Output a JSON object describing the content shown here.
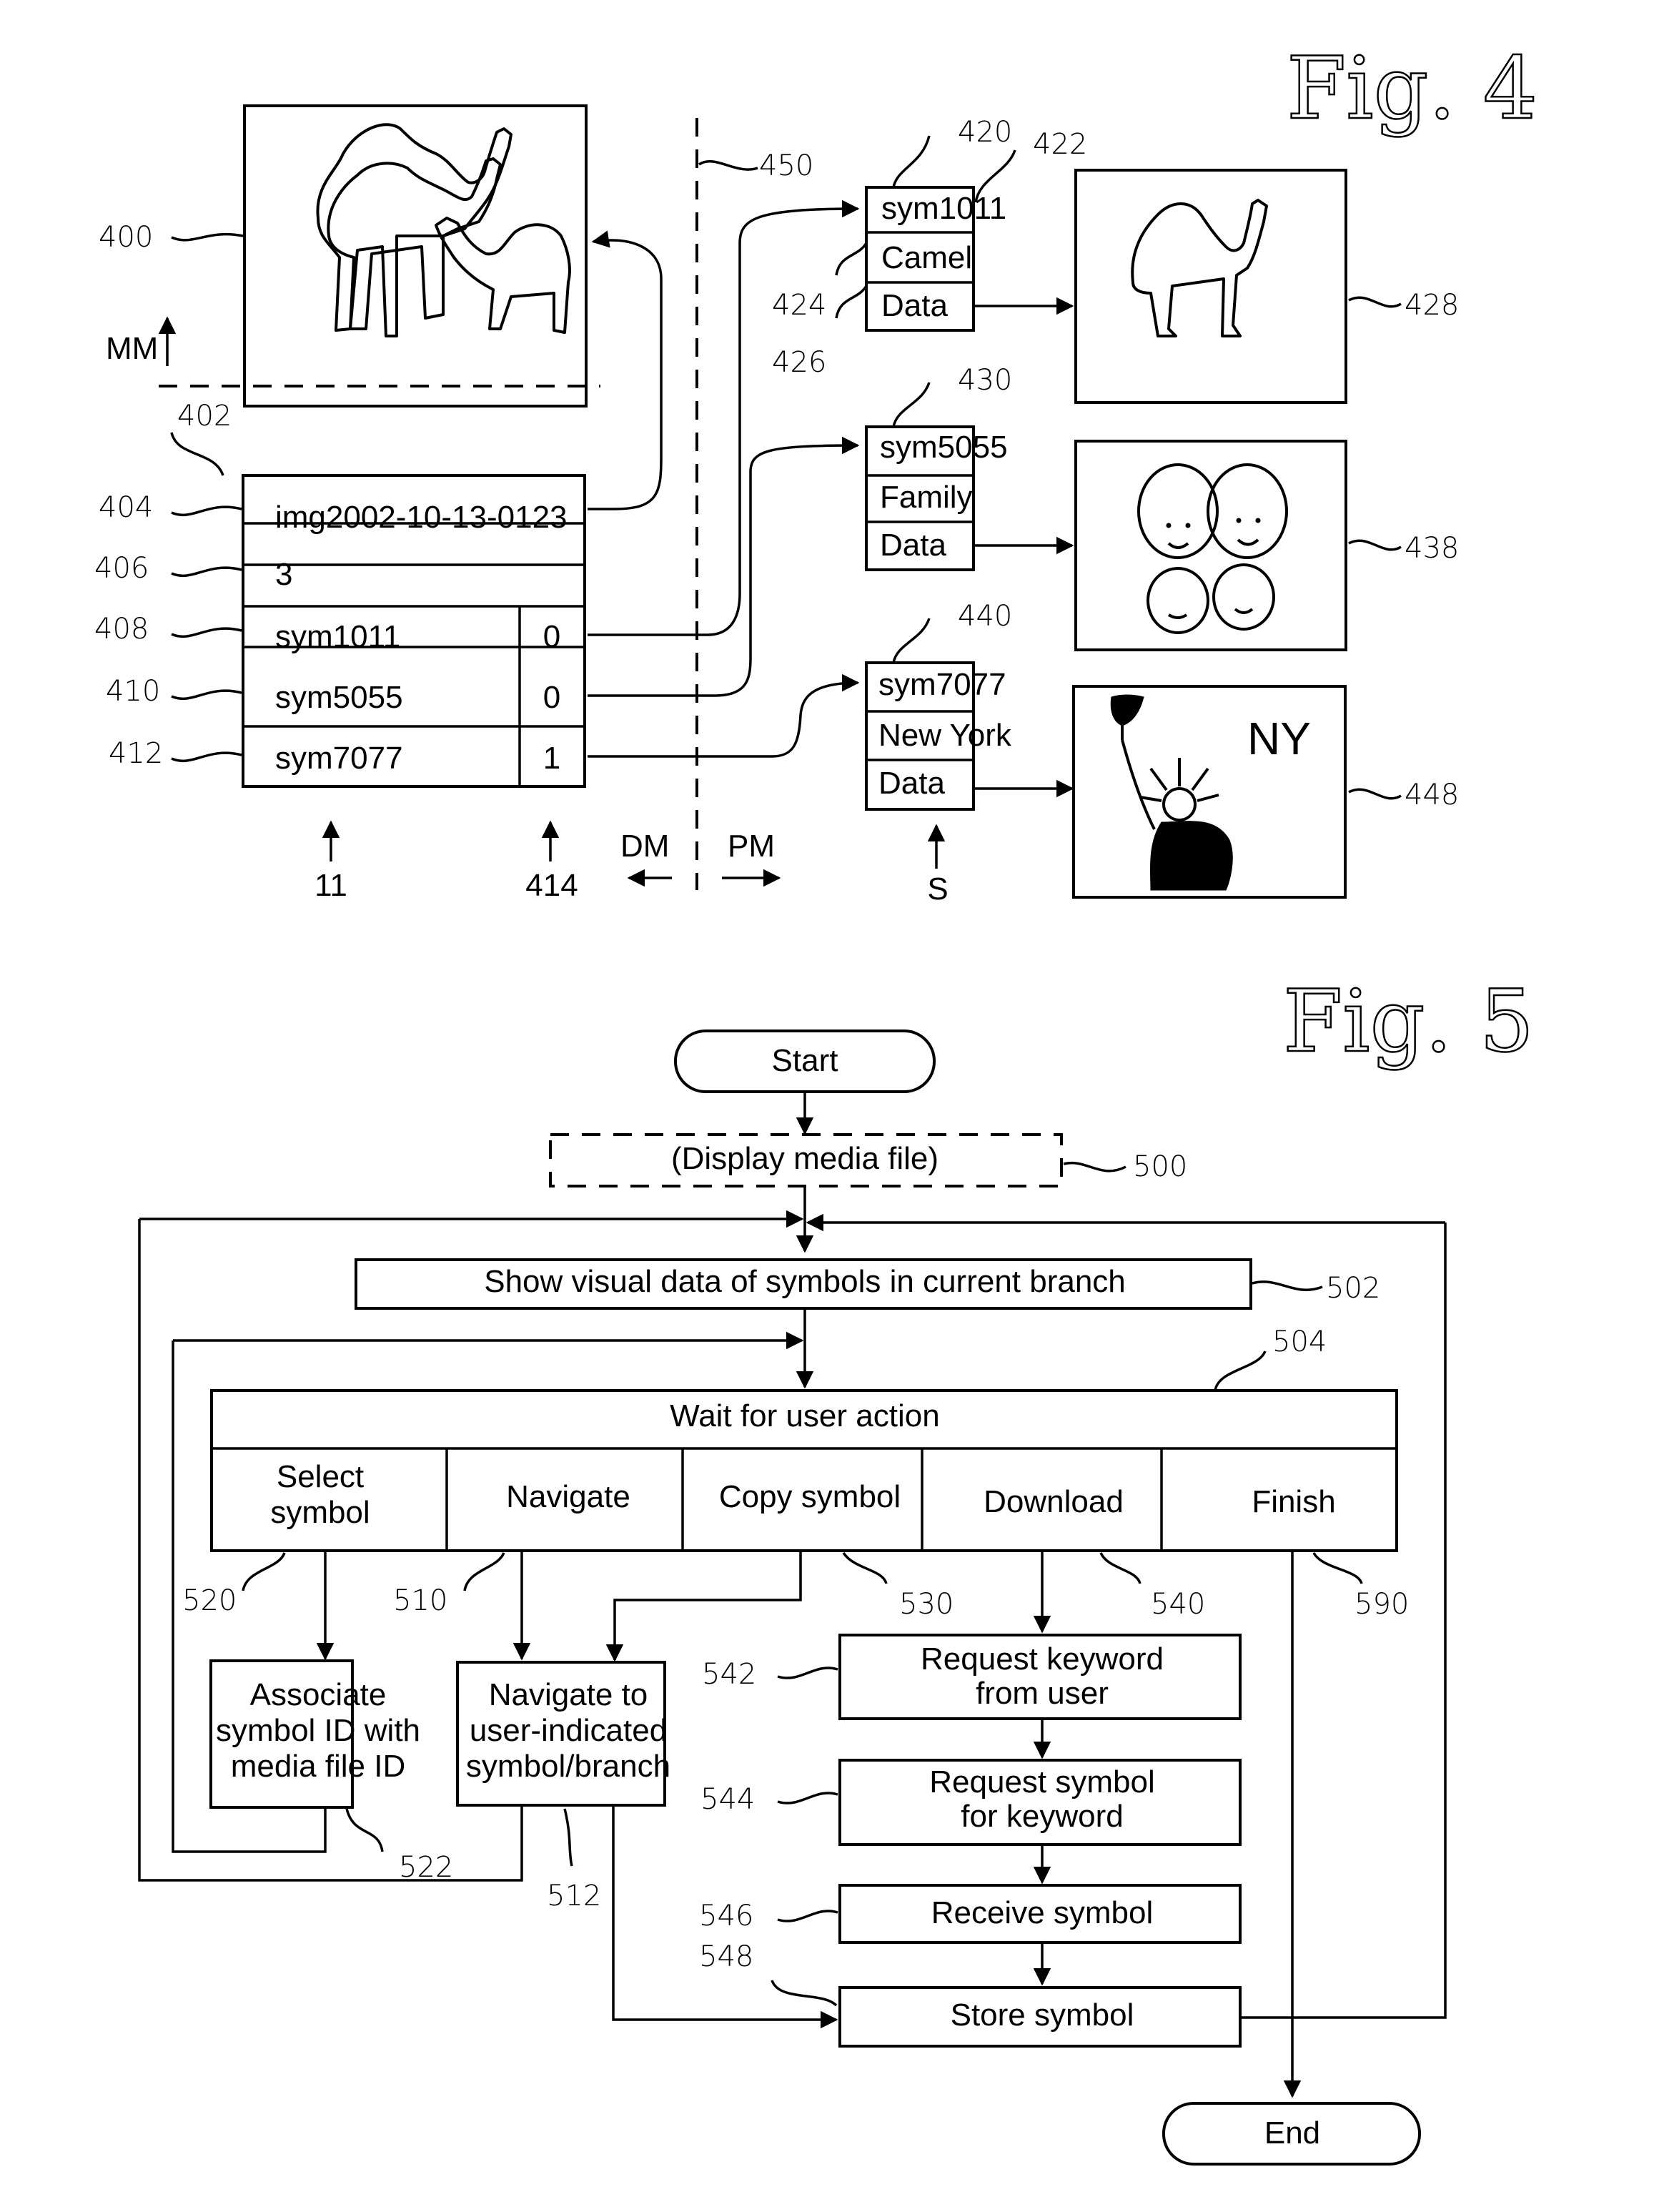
{
  "fig4": {
    "title": "Fig. 4",
    "media_file": {
      "ref": "400",
      "image": "camels-icon",
      "mm_label": "MM"
    },
    "record": {
      "ref": "402",
      "rows": [
        {
          "ref": "404",
          "value": "img2002-10-13-0123"
        },
        {
          "ref": "406",
          "value": "3"
        },
        {
          "ref": "408",
          "value": "sym1011",
          "flag": "0"
        },
        {
          "ref": "410",
          "value": "sym5055",
          "flag": "0"
        },
        {
          "ref": "412",
          "value": "sym7077",
          "flag": "1"
        }
      ],
      "col_ref_ids": "11",
      "col_ref_flags": "414"
    },
    "divider_ref": "450",
    "dm_label": "DM",
    "pm_label": "PM",
    "s_label": "S",
    "symbols": [
      {
        "ref": "420",
        "id_ref": "422",
        "name_ref": "424",
        "data_ref": "426",
        "id": "sym1011",
        "name": "Camel",
        "data": "Data",
        "image_ref": "428",
        "image": "camel-icon"
      },
      {
        "ref": "430",
        "id": "sym5055",
        "name": "Family",
        "data": "Data",
        "image_ref": "438",
        "image": "family-icon"
      },
      {
        "ref": "440",
        "id": "sym7077",
        "name": "New York",
        "data": "Data",
        "image_ref": "448",
        "image": "statue-of-liberty-icon",
        "image_text": "NY"
      }
    ]
  },
  "fig5": {
    "title": "Fig. 5",
    "start": "Start",
    "end": "End",
    "display_media": {
      "label": "(Display media file)",
      "ref": "500"
    },
    "show_visual": {
      "label": "Show visual data of symbols in current branch",
      "ref": "502"
    },
    "wait": {
      "label": "Wait for user action",
      "ref": "504"
    },
    "actions": [
      {
        "label_1": "Select",
        "label_2": "symbol",
        "ref": "520"
      },
      {
        "label_1": "Navigate",
        "label_2": "",
        "ref": "510"
      },
      {
        "label_1": "Copy symbol",
        "label_2": "",
        "ref": "530"
      },
      {
        "label_1": "Download",
        "label_2": "",
        "ref": "540"
      },
      {
        "label_1": "Finish",
        "label_2": "",
        "ref": "590"
      }
    ],
    "associate": {
      "lines": [
        "Associate",
        "symbol ID with",
        "media file ID"
      ],
      "ref": "522"
    },
    "navigate_to": {
      "lines": [
        "Navigate to",
        "user-indicated",
        "symbol/branch"
      ],
      "ref": "512"
    },
    "download_steps": [
      {
        "lines": [
          "Request keyword",
          "from user"
        ],
        "ref": "542"
      },
      {
        "lines": [
          "Request symbol",
          "for keyword"
        ],
        "ref": "544"
      },
      {
        "lines": [
          "Receive symbol"
        ],
        "ref": "546"
      },
      {
        "lines": [
          "Store symbol"
        ],
        "ref": "548"
      }
    ]
  }
}
